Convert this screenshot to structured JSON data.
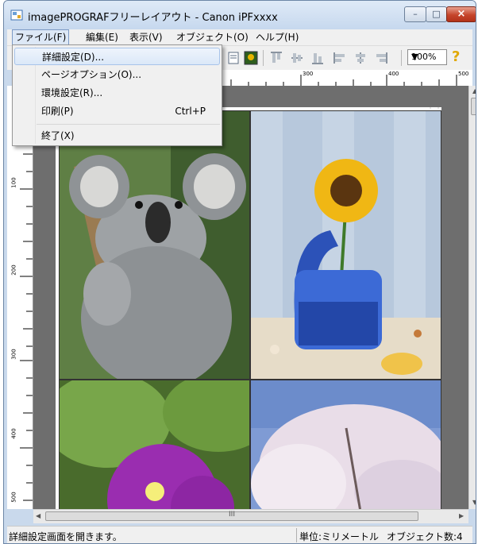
{
  "window": {
    "title": "imagePROGRAFフリーレイアウト - Canon iPFxxxx",
    "buttons": {
      "minimize": "–",
      "maximize": "□",
      "close": "×"
    }
  },
  "menubar": {
    "items": [
      {
        "label": "ファイル(F)",
        "active": true
      },
      {
        "label": "編集(E)"
      },
      {
        "label": "表示(V)"
      },
      {
        "label": "オブジェクト(O)"
      },
      {
        "label": "ヘルプ(H)"
      }
    ]
  },
  "file_menu": {
    "items": [
      {
        "label": "詳細設定(D)...",
        "shortcut": "",
        "highlighted": true
      },
      {
        "label": "ページオプション(O)...",
        "shortcut": ""
      },
      {
        "label": "環境設定(R)...",
        "shortcut": ""
      },
      {
        "label": "印刷(P)",
        "shortcut": "Ctrl+P"
      },
      {
        "label": "終了(X)",
        "shortcut": ""
      }
    ]
  },
  "toolbar": {
    "zoom_value": "100%",
    "help_glyph": "?",
    "icons": [
      "page-icon",
      "image-icon",
      "align-top-icon",
      "align-center-vertical-icon",
      "align-bottom-icon",
      "align-left-icon",
      "align-center-horizontal-icon",
      "align-right-icon"
    ]
  },
  "ruler": {
    "horizontal_labels": [
      "300",
      "400",
      "500"
    ],
    "vertical_labels": [
      "100",
      "200",
      "300",
      "400",
      "500"
    ]
  },
  "canvas": {
    "photos": [
      "koala",
      "sunflower",
      "bougainvillea",
      "cherry-blossom"
    ]
  },
  "scrollbar": {
    "thumb_grip": "III"
  },
  "status": {
    "message": "詳細設定画面を開きます。",
    "unit": "単位:ミリメートル",
    "object_count": "オブジェクト数:4"
  },
  "colors": {
    "titlebar": "#c6d8ee",
    "close_button": "#c5452b",
    "canvas_bg": "#6e6e6e",
    "menu_highlight": "#dbe8f8"
  }
}
